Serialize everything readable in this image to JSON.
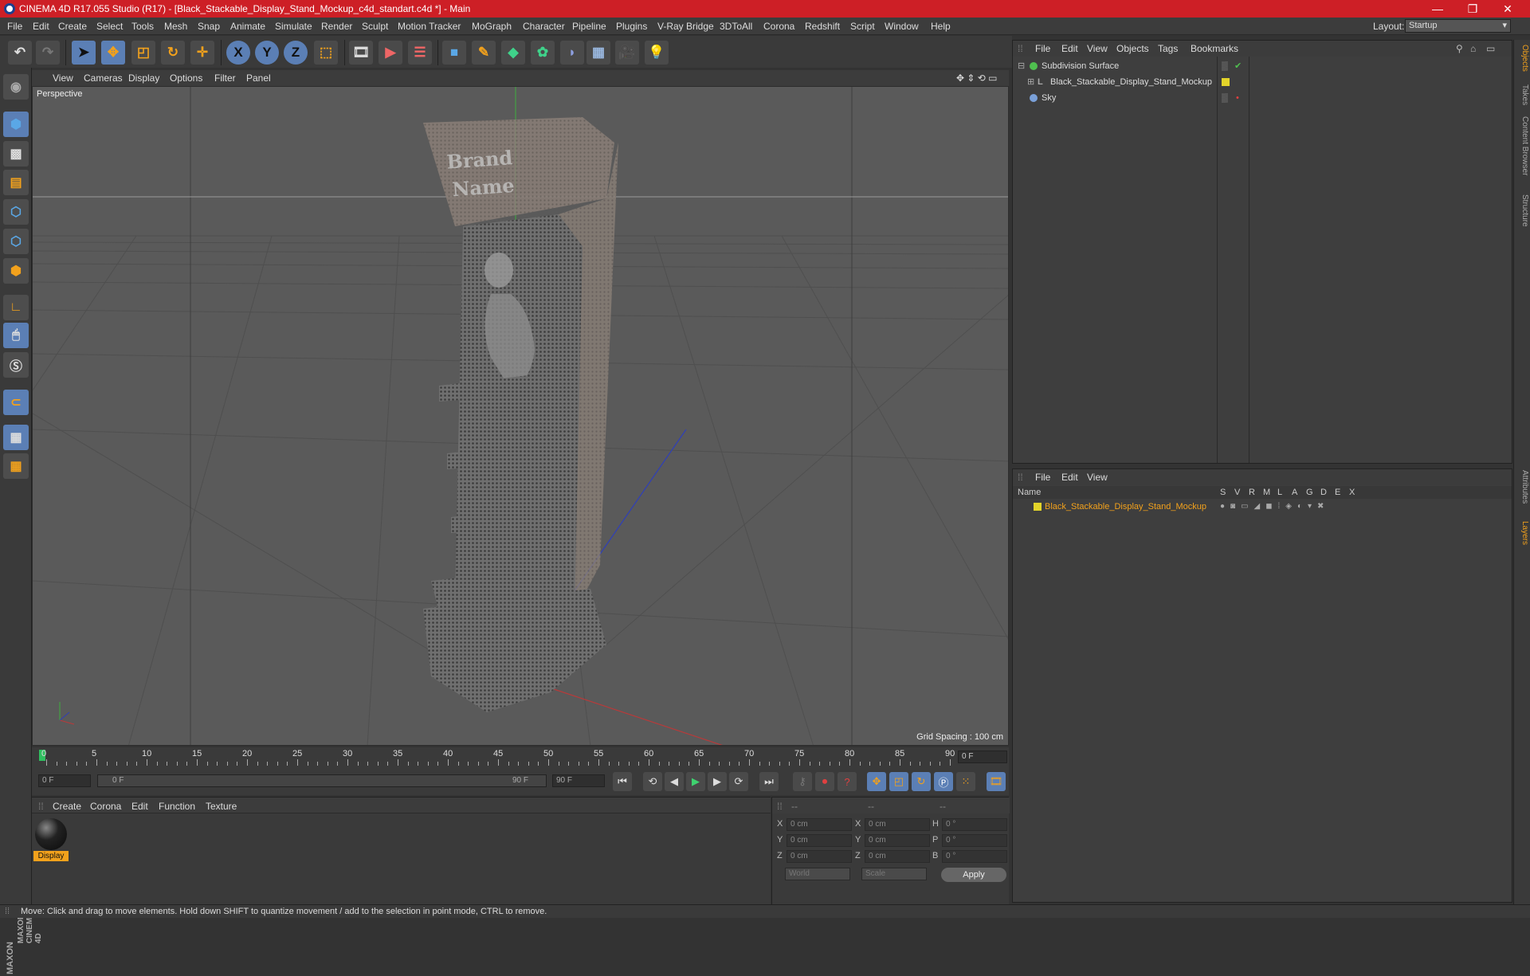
{
  "app": {
    "title": "CINEMA 4D R17.055 Studio (R17) - [Black_Stackable_Display_Stand_Mockup_c4d_standart.c4d *] - Main",
    "window_controls": [
      "—",
      "❐",
      "✕"
    ]
  },
  "menu": {
    "items": [
      "File",
      "Edit",
      "Create",
      "Select",
      "Tools",
      "Mesh",
      "Snap",
      "Animate",
      "Simulate",
      "Render",
      "Sculpt",
      "Motion Tracker",
      "MoGraph",
      "Character",
      "Pipeline",
      "Plugins",
      "V-Ray Bridge",
      "3DToAll",
      "Corona",
      "Redshift",
      "Script",
      "Window",
      "Help"
    ],
    "layout_label": "Layout:",
    "layout_value": "Startup"
  },
  "toolbar": {
    "tools": [
      "undo-icon",
      "redo-icon",
      "select-arrow-icon",
      "move-icon",
      "scale-icon",
      "rotate-icon",
      "move-all-icon",
      "x-axis-icon",
      "y-axis-icon",
      "z-axis-icon",
      "coord-system-icon",
      "render-region-icon",
      "render-view-icon",
      "render-queue-icon",
      "cube-icon",
      "pen-icon",
      "subdivision-icon",
      "cloner-icon",
      "deformer-icon",
      "floor-icon",
      "camera-icon",
      "light-icon"
    ],
    "axis_labels": [
      "X",
      "Y",
      "Z"
    ]
  },
  "viewport": {
    "menu": [
      "View",
      "Cameras",
      "Display",
      "Options",
      "Filter",
      "Panel"
    ],
    "label": "Perspective",
    "grid_spacing": "Grid Spacing : 100 cm",
    "sign_text_1": "Brand",
    "sign_text_2": "Name"
  },
  "timeline": {
    "ticks": [
      "0",
      "5",
      "10",
      "15",
      "20",
      "25",
      "30",
      "35",
      "40",
      "45",
      "50",
      "55",
      "60",
      "65",
      "70",
      "75",
      "80",
      "85",
      "90"
    ],
    "current_frame": "0 F",
    "start_field": "0 F",
    "range_start": "0 F",
    "range_end": "90 F",
    "end_field": "90 F"
  },
  "materials": {
    "menu": [
      "Create",
      "Corona",
      "Edit",
      "Function",
      "Texture"
    ],
    "items": [
      {
        "name": "Display"
      }
    ]
  },
  "coordinates": {
    "headers": [
      "--",
      "--",
      "--"
    ],
    "rows": [
      {
        "a": "X",
        "v1": "0 cm",
        "b": "X",
        "v2": "0 cm",
        "c": "H",
        "v3": "0 °"
      },
      {
        "a": "Y",
        "v1": "0 cm",
        "b": "Y",
        "v2": "0 cm",
        "c": "P",
        "v3": "0 °"
      },
      {
        "a": "Z",
        "v1": "0 cm",
        "b": "Z",
        "v2": "0 cm",
        "c": "B",
        "v3": "0 °"
      }
    ],
    "mode1": "World",
    "mode2": "Scale",
    "apply": "Apply"
  },
  "object_manager": {
    "menu": [
      "File",
      "Edit",
      "View",
      "Objects",
      "Tags",
      "Bookmarks"
    ],
    "objects": [
      {
        "name": "Subdivision Surface",
        "color": "#4fbf4f"
      },
      {
        "name": "Black_Stackable_Display_Stand_Mockup",
        "color": "#e3d42a"
      },
      {
        "name": "Sky",
        "color": "#7aa0d8"
      }
    ]
  },
  "layer_manager": {
    "menu": [
      "File",
      "Edit",
      "View"
    ],
    "columns": [
      "Name",
      "S",
      "V",
      "R",
      "M",
      "L",
      "A",
      "G",
      "D",
      "E",
      "X"
    ],
    "layers": [
      {
        "name": "Black_Stackable_Display_Stand_Mockup",
        "color": "#e3d42a"
      }
    ]
  },
  "right_tabs": [
    "Objects",
    "Takes",
    "Content Browser",
    "Structure",
    "Attributes",
    "Layers"
  ],
  "status": "Move: Click and drag to move elements. Hold down SHIFT to quantize movement / add to the selection in point mode, CTRL to remove.",
  "brand": "MAXON CINEMA 4D"
}
